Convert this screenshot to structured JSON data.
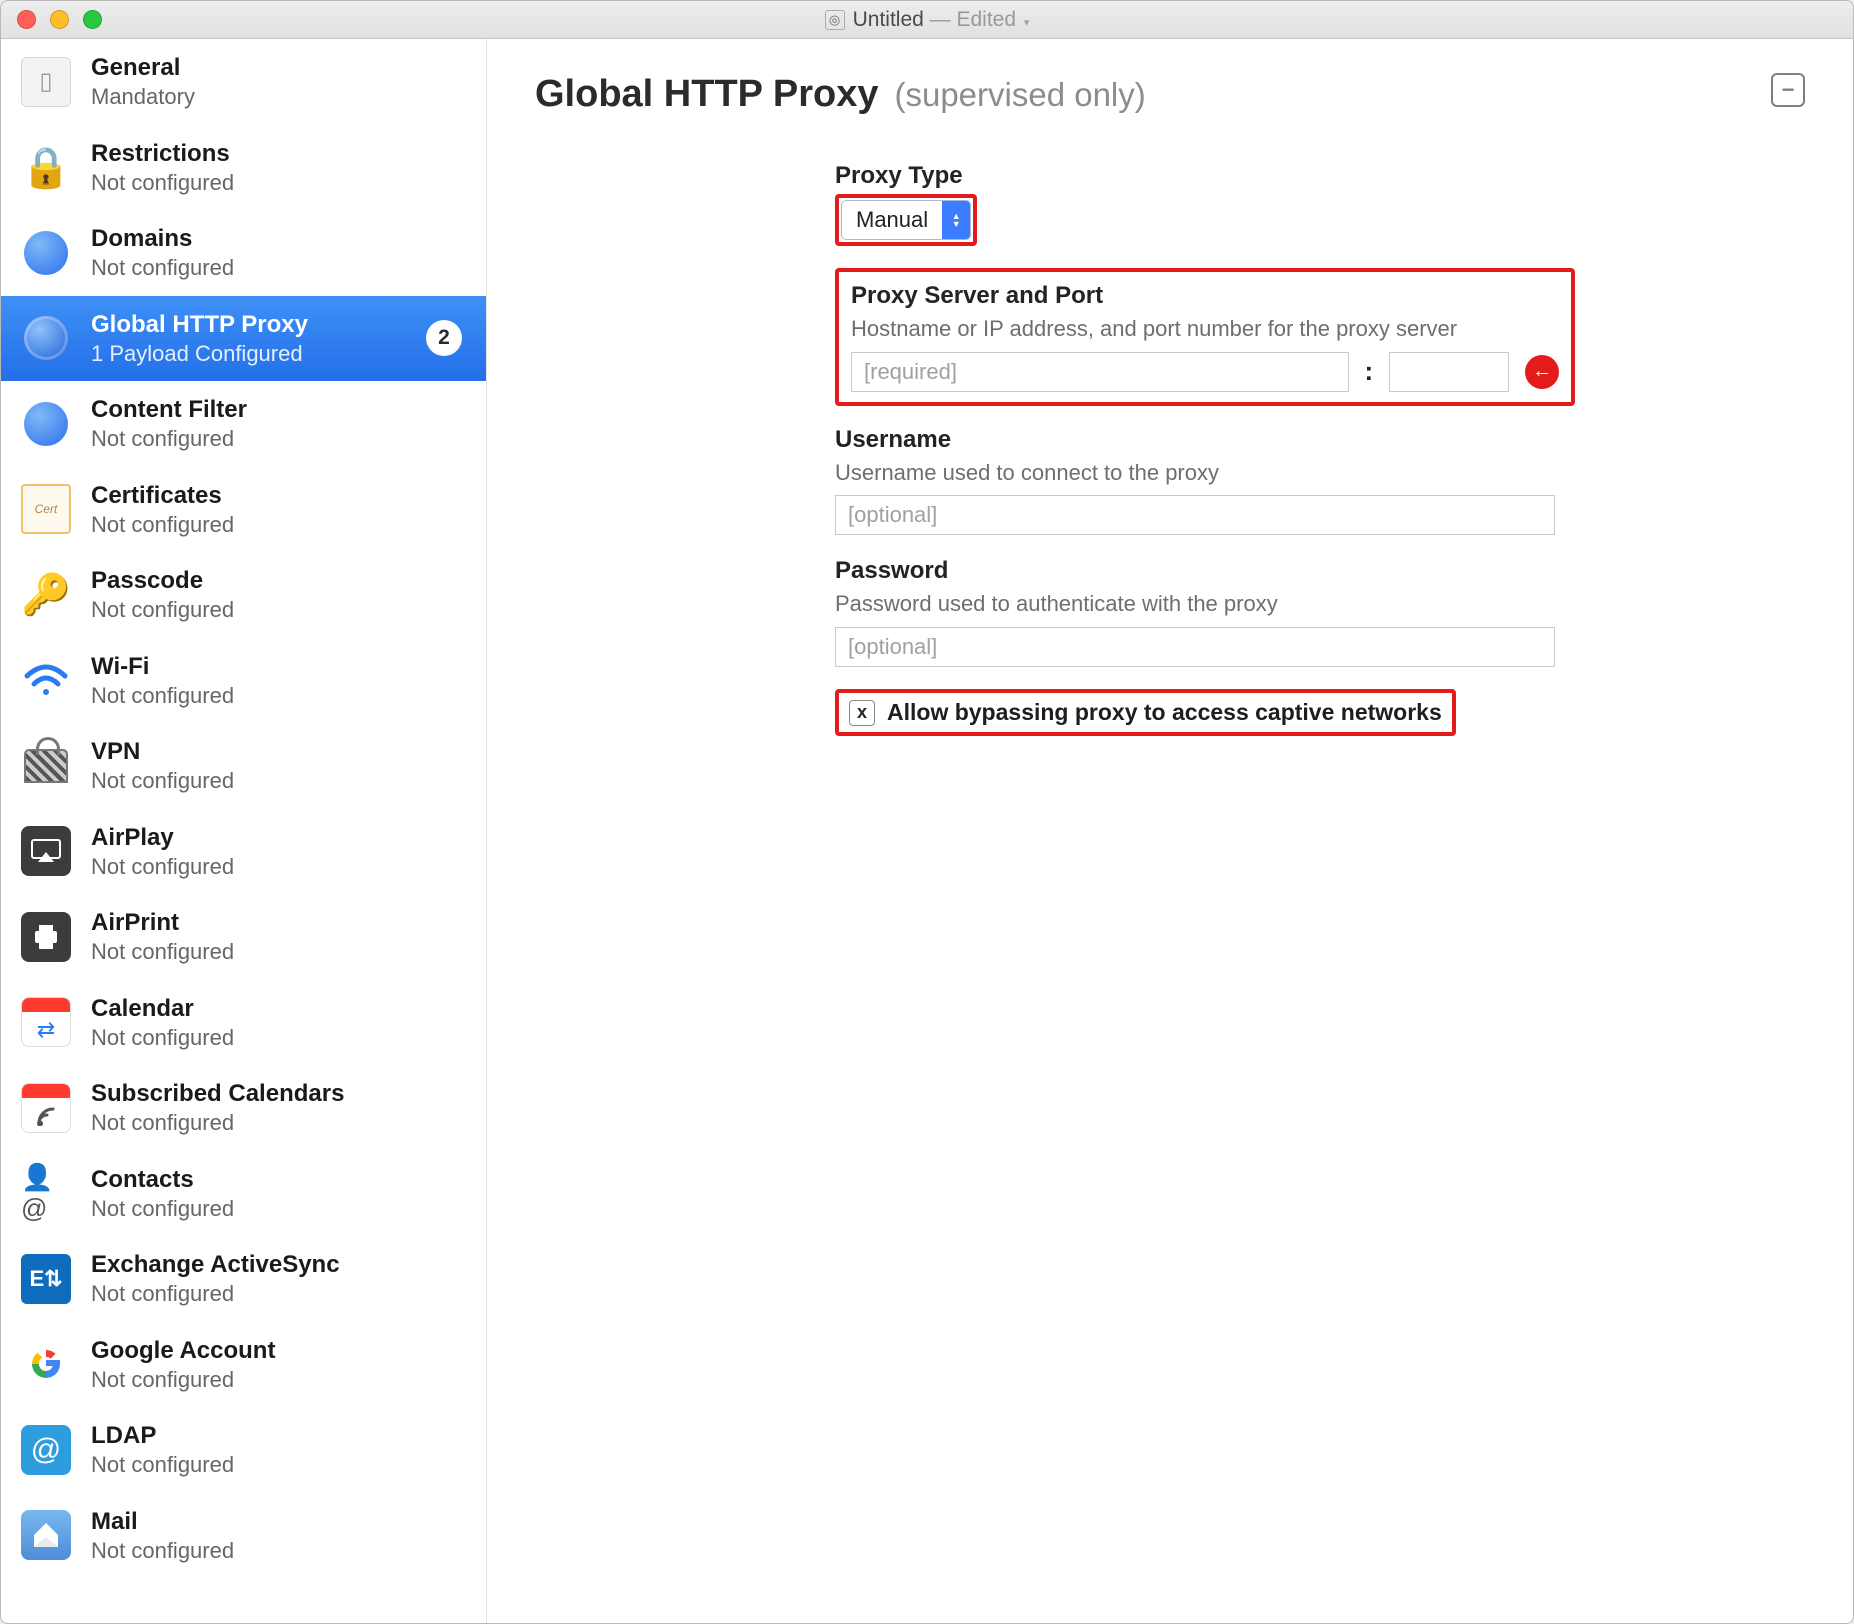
{
  "window": {
    "title": "Untitled",
    "edited_suffix": "— Edited",
    "traffic_colors": {
      "close": "#ff5f57",
      "min": "#ffbd2e",
      "max": "#28c940"
    }
  },
  "sidebar": {
    "items": [
      {
        "icon": "device-icon",
        "title": "General",
        "sub": "Mandatory"
      },
      {
        "icon": "lock-icon",
        "title": "Restrictions",
        "sub": "Not configured"
      },
      {
        "icon": "globe-icon",
        "title": "Domains",
        "sub": "Not configured"
      },
      {
        "icon": "globe-proxy-icon",
        "title": "Global HTTP Proxy",
        "sub": "1 Payload Configured",
        "selected": true,
        "badge": "2"
      },
      {
        "icon": "globe-filter-icon",
        "title": "Content Filter",
        "sub": "Not configured"
      },
      {
        "icon": "certificate-icon",
        "title": "Certificates",
        "sub": "Not configured"
      },
      {
        "icon": "key-icon",
        "title": "Passcode",
        "sub": "Not configured"
      },
      {
        "icon": "wifi-icon",
        "title": "Wi-Fi",
        "sub": "Not configured"
      },
      {
        "icon": "vpn-icon",
        "title": "VPN",
        "sub": "Not configured"
      },
      {
        "icon": "airplay-icon",
        "title": "AirPlay",
        "sub": "Not configured"
      },
      {
        "icon": "airprint-icon",
        "title": "AirPrint",
        "sub": "Not configured"
      },
      {
        "icon": "calendar-icon",
        "title": "Calendar",
        "sub": "Not configured"
      },
      {
        "icon": "subscribed-cal-icon",
        "title": "Subscribed Calendars",
        "sub": "Not configured"
      },
      {
        "icon": "contacts-icon",
        "title": "Contacts",
        "sub": "Not configured"
      },
      {
        "icon": "exchange-icon",
        "title": "Exchange ActiveSync",
        "sub": "Not configured"
      },
      {
        "icon": "google-icon",
        "title": "Google Account",
        "sub": "Not configured"
      },
      {
        "icon": "ldap-icon",
        "title": "LDAP",
        "sub": "Not configured"
      },
      {
        "icon": "mail-icon",
        "title": "Mail",
        "sub": "Not configured"
      }
    ]
  },
  "page": {
    "title": "Global HTTP Proxy",
    "subtitle": "(supervised only)",
    "minus_label": "−"
  },
  "form": {
    "proxy_type": {
      "label": "Proxy Type",
      "value": "Manual"
    },
    "server": {
      "label": "Proxy Server and Port",
      "desc": "Hostname or IP address, and port number for the proxy server",
      "host_placeholder": "[required]",
      "host_value": "",
      "port_value": "",
      "colon": ":",
      "error_icon": "←"
    },
    "username": {
      "label": "Username",
      "desc": "Username used to connect to the proxy",
      "placeholder": "[optional]",
      "value": ""
    },
    "password": {
      "label": "Password",
      "desc": "Password used to authenticate with the proxy",
      "placeholder": "[optional]",
      "value": ""
    },
    "bypass": {
      "checked_glyph": "x",
      "label": "Allow bypassing proxy to access captive networks"
    }
  },
  "highlight_color": "#e41b1b"
}
